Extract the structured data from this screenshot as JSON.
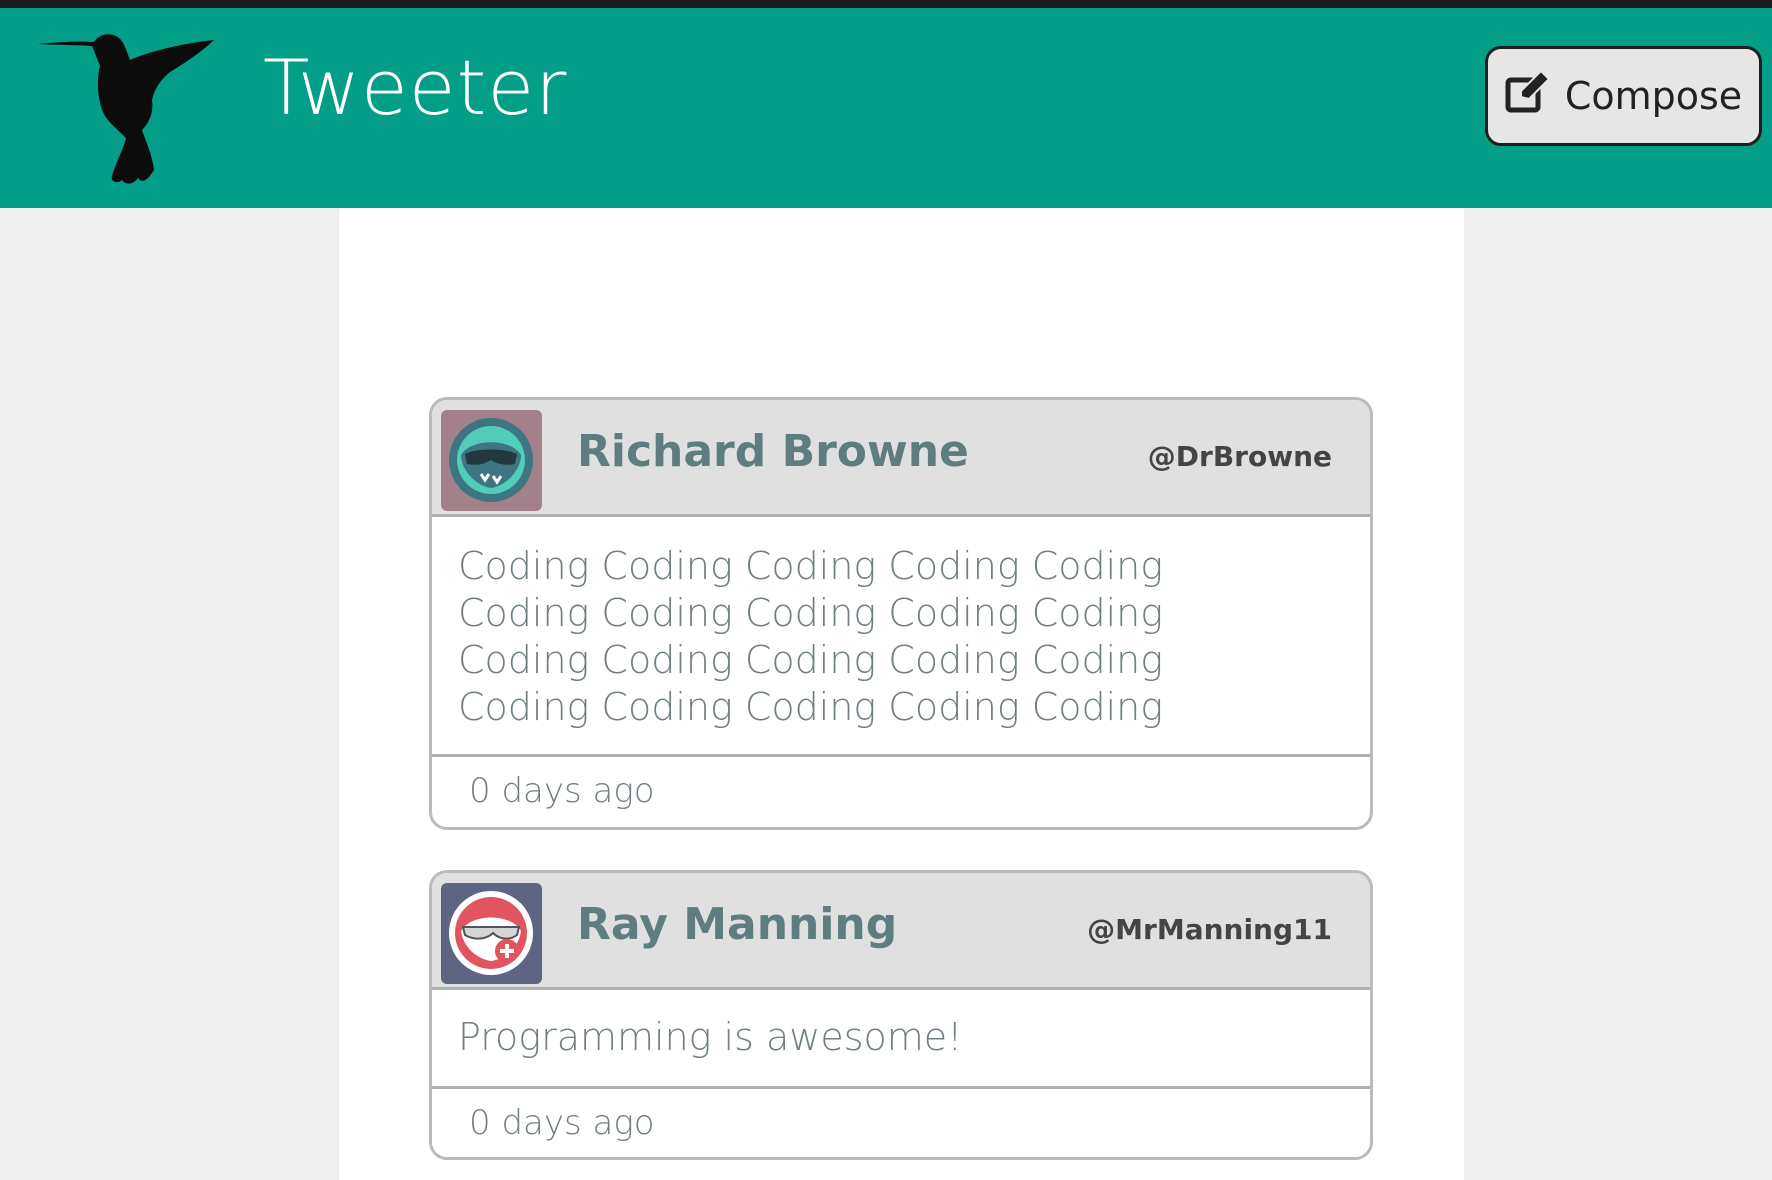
{
  "navbar": {
    "brand": "Tweeter",
    "logo_icon": "hummingbird-icon",
    "compose_label": "Compose",
    "compose_icon": "edit-icon",
    "color": "#029e88"
  },
  "tweets": [
    {
      "name": "Richard Browne",
      "handle": "@DrBrowne",
      "text": "Coding Coding Coding Coding Coding Coding Coding Coding Coding Coding Coding Coding Coding Coding Coding Coding Coding Coding Coding Coding",
      "time": "0 days ago",
      "avatar_icon": "masked-face-avatar"
    },
    {
      "name": "Ray Manning",
      "handle": "@MrManning11",
      "text": "Programming is awesome!",
      "time": "0 days ago",
      "avatar_icon": "sunglasses-face-avatar"
    }
  ]
}
